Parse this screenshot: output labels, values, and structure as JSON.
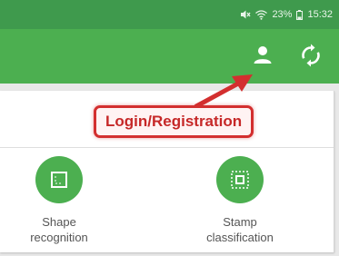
{
  "status_bar": {
    "icons": [
      "mute-icon",
      "wifi-icon",
      "battery-icon"
    ],
    "battery_percent": "23%",
    "time": "15:32"
  },
  "toolbar": {
    "color": "#4caf50",
    "actions": [
      "account-icon",
      "sync-icon"
    ]
  },
  "annotation": {
    "label": "Login/Registration",
    "color": "#d32f2f"
  },
  "tiles": [
    {
      "label_line1": "Shape",
      "label_line2": "recognition",
      "icon": "shape-recognition-icon"
    },
    {
      "label_line1": "Stamp",
      "label_line2": "classification",
      "icon": "stamp-classification-icon"
    }
  ]
}
